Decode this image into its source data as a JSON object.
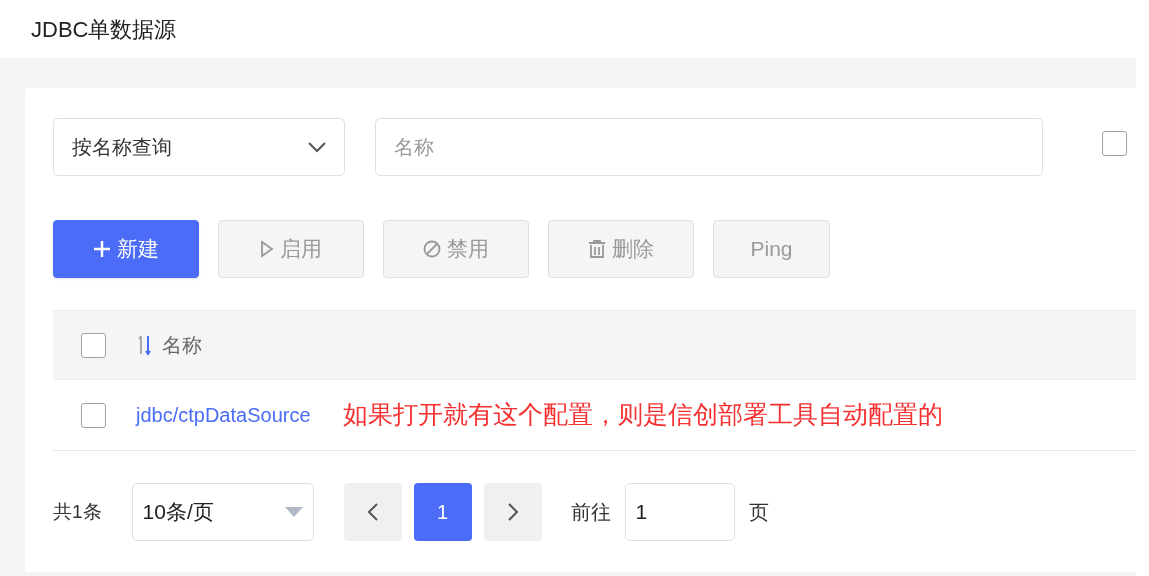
{
  "page_title": "JDBC单数据源",
  "search": {
    "mode": "按名称查询",
    "placeholder": "名称",
    "extra_checkbox": {
      "checked": false
    }
  },
  "toolbar": [
    {
      "kind": "create",
      "label": "新建",
      "disabled": false
    },
    {
      "kind": "enable",
      "label": "启用",
      "disabled": true
    },
    {
      "kind": "disable",
      "label": "禁用",
      "disabled": true
    },
    {
      "kind": "delete",
      "label": "删除",
      "disabled": true
    },
    {
      "kind": "ping",
      "label": "Ping",
      "disabled": true
    }
  ],
  "table": {
    "header_checked": false,
    "columns": [
      "名称"
    ],
    "rows": [
      {
        "checked": false,
        "name": "jdbc/ctpDataSource",
        "annotation": "如果打开就有这个配置，则是信创部署工具自动配置的"
      }
    ]
  },
  "pagination": {
    "total": "共1条",
    "page_size": "10条/页",
    "pages": [
      {
        "label": "1",
        "selected": true
      }
    ],
    "goto_label": "前往",
    "goto_value": "1",
    "page_unit": "页"
  }
}
